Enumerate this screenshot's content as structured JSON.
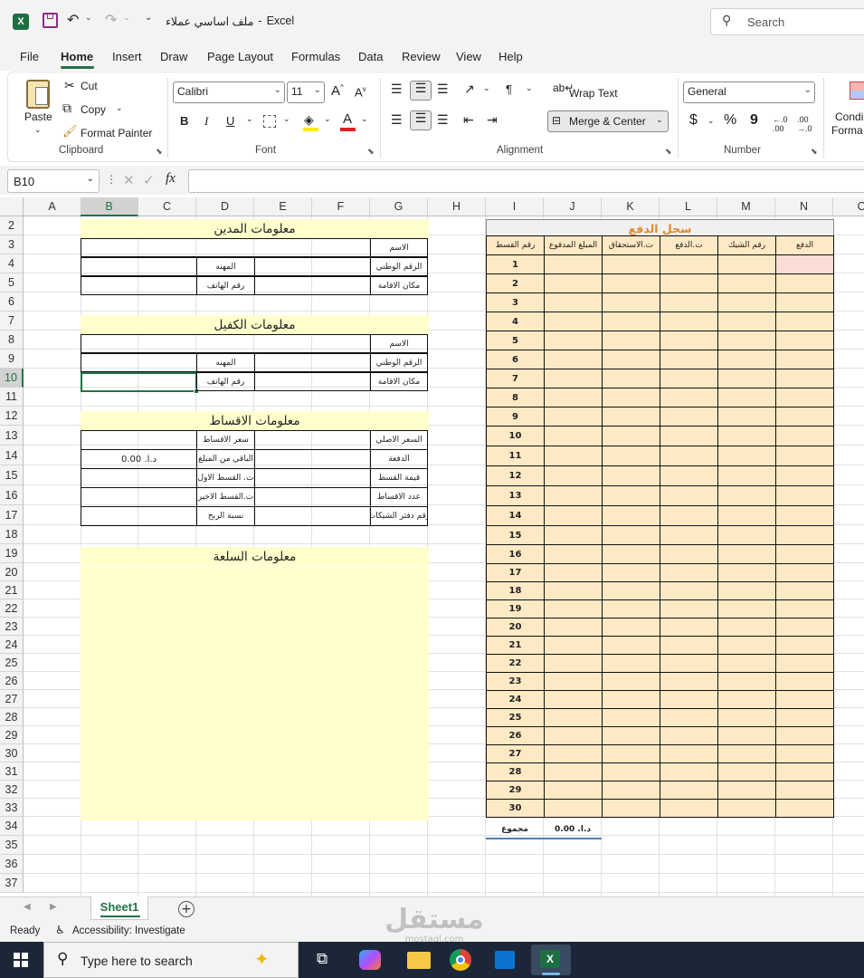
{
  "window": {
    "doc_title": "ملف اساسي عملاء",
    "app_name": "Excel",
    "title_sep": "-",
    "search_placeholder": "Search"
  },
  "menu": [
    "File",
    "Home",
    "Insert",
    "Draw",
    "Page Layout",
    "Formulas",
    "Data",
    "Review",
    "View",
    "Help"
  ],
  "menu_active": "Home",
  "ribbon": {
    "clipboard": {
      "paste": "Paste",
      "cut": "Cut",
      "copy": "Copy",
      "format_painter": "Format Painter",
      "label": "Clipboard"
    },
    "font": {
      "name": "Calibri",
      "size": "11",
      "label": "Font",
      "bold": "B",
      "italic": "I",
      "underline": "U"
    },
    "alignment": {
      "wrap_text": "Wrap Text",
      "merge_center": "Merge & Center",
      "label": "Alignment"
    },
    "number": {
      "format": "General",
      "label": "Number",
      "currency": "$",
      "percent": "%",
      "comma": "9"
    },
    "styles": {
      "conditional_1": "Condi",
      "conditional_2": "Forma"
    }
  },
  "formula_bar": {
    "name_box": "B10",
    "fx": "fx",
    "value": ""
  },
  "columns": [
    "A",
    "B",
    "C",
    "D",
    "E",
    "F",
    "G",
    "H",
    "I",
    "J",
    "K",
    "L",
    "M",
    "N",
    "O"
  ],
  "rows": [
    "2",
    "3",
    "4",
    "5",
    "6",
    "7",
    "8",
    "9",
    "10",
    "11",
    "12",
    "13",
    "14",
    "15",
    "16",
    "17",
    "18",
    "19",
    "20",
    "21",
    "22",
    "23",
    "24",
    "25",
    "26",
    "27",
    "28",
    "29",
    "30",
    "31",
    "32",
    "33",
    "34",
    "35",
    "36",
    "37"
  ],
  "sheet": {
    "debtor": {
      "title": "معلومات المدين",
      "name_label": "الاسم",
      "national_id_label": "الرقم الوطني",
      "residence_label": "مكان الاقامة",
      "job_label": "المهنه",
      "phone_label": "رقم الهاتف"
    },
    "guarantor": {
      "title": "معلومات الكفيل",
      "name_label": "الاسم",
      "national_id_label": "الرقم الوطني",
      "residence_label": "مكان الاقامة",
      "job_label": "المهنه",
      "phone_label": "رقم الهاتف"
    },
    "installments": {
      "title": "معلومات الاقساط",
      "original_price": "السعر الاصلي",
      "down_payment": "الدفعة",
      "installment_value": "قيمة القسط",
      "installment_count": "عدد الاقساط",
      "checkbook_no": "رقم دفتر الشيكات",
      "installment_price": "سعر الاقساط",
      "remaining": "الباقي من المبلغ",
      "first_date": "ت. القسط الاول",
      "last_date": "ت.القسط الاخير",
      "profit_rate": "نسبة الربح",
      "remaining_value": "د.ا. 0.00"
    },
    "goods": {
      "title": "معلومات السلعة"
    },
    "payments": {
      "title": "سجل الدفع",
      "headers": [
        "الدفع",
        "رقم الشيك",
        "ت.الدفع",
        "ت.الاستحقاق",
        "المبلغ المدفوع",
        "رقم القسط"
      ],
      "numbers": [
        "1",
        "2",
        "3",
        "4",
        "5",
        "6",
        "7",
        "8",
        "9",
        "10",
        "11",
        "12",
        "13",
        "14",
        "15",
        "16",
        "17",
        "18",
        "19",
        "20",
        "21",
        "22",
        "23",
        "24",
        "25",
        "26",
        "27",
        "28",
        "29",
        "30"
      ],
      "total_label": "مجموع",
      "total_value": "د.ا. 0.00"
    }
  },
  "sheet_tabs": [
    "Sheet1"
  ],
  "status": {
    "ready": "Ready",
    "accessibility": "Accessibility: Investigate"
  },
  "taskbar": {
    "search_placeholder": "Type here to search"
  },
  "watermark": {
    "text": "مستقل",
    "sub": "mostaql.com"
  },
  "colors": {
    "excel_green": "#217346",
    "yellow_fill": "#ffffcc",
    "peach_fill": "#fde9c4",
    "title_orange": "#e08a2e"
  }
}
